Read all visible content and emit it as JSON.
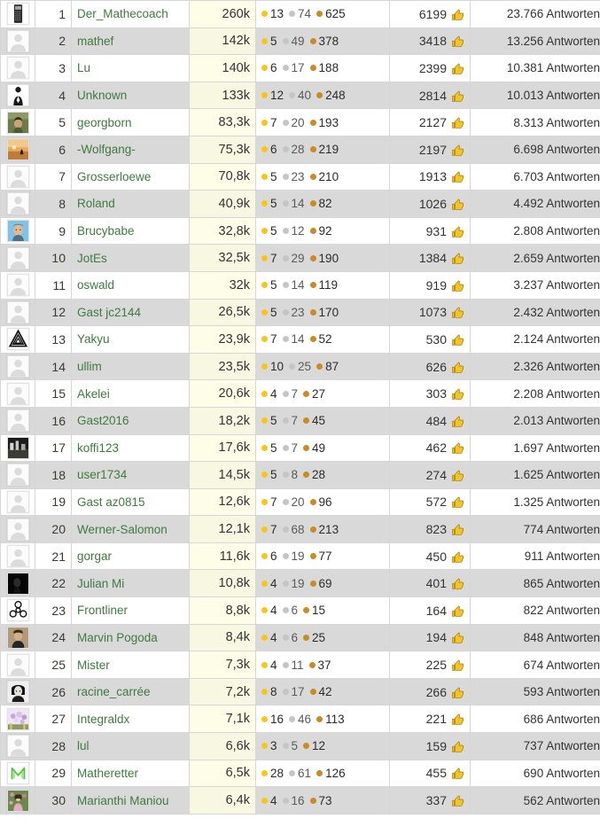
{
  "table": {
    "answers_suffix": "Antworten",
    "colors": {
      "gold": "#fcc418",
      "silver": "#c5c5c5",
      "bronze": "#cc8a24",
      "username": "#3f7a3f",
      "reputation_cell_bg": "#fdfde8",
      "row_even_bg": "#d9d9d9",
      "heart": "#d93025",
      "thumb": "#f5c518"
    },
    "icons": {
      "thumbs_up": "thumbs-up-icon",
      "heart": "heart-icon",
      "gold_badge": "gold-badge-dot",
      "silver_badge": "silver-badge-dot",
      "bronze_badge": "bronze-badge-dot"
    },
    "rows": [
      {
        "rank": "1",
        "name": "Der_Mathecoach",
        "reputation": "260k",
        "gold": "13",
        "silver": "74",
        "bronze": "625",
        "votes": "6199",
        "answers": "23.766 Antworten",
        "heart": false,
        "avatar": "calculator"
      },
      {
        "rank": "2",
        "name": "mathef",
        "reputation": "142k",
        "gold": "5",
        "silver": "49",
        "bronze": "378",
        "votes": "3418",
        "answers": "13.256 Antworten",
        "heart": false,
        "avatar": "default"
      },
      {
        "rank": "3",
        "name": "Lu",
        "reputation": "140k",
        "gold": "6",
        "silver": "17",
        "bronze": "188",
        "votes": "2399",
        "answers": "10.381 Antworten",
        "heart": false,
        "avatar": "default"
      },
      {
        "rank": "4",
        "name": "Unknown",
        "reputation": "133k",
        "gold": "12",
        "silver": "40",
        "bronze": "248",
        "votes": "2814",
        "answers": "10.013 Antworten",
        "heart": false,
        "avatar": "suit"
      },
      {
        "rank": "5",
        "name": "georgborn",
        "reputation": "83,3k",
        "gold": "7",
        "silver": "20",
        "bronze": "193",
        "votes": "2127",
        "answers": "8.313 Antworten",
        "heart": false,
        "avatar": "photo-person"
      },
      {
        "rank": "6",
        "name": "-Wolfgang-",
        "reputation": "75,3k",
        "gold": "6",
        "silver": "28",
        "bronze": "219",
        "votes": "2197",
        "answers": "6.698 Antworten",
        "heart": false,
        "avatar": "photo-sunset"
      },
      {
        "rank": "7",
        "name": "Grosserloewe",
        "reputation": "70,8k",
        "gold": "5",
        "silver": "23",
        "bronze": "210",
        "votes": "1913",
        "answers": "6.703 Antworten",
        "heart": false,
        "avatar": "default"
      },
      {
        "rank": "8",
        "name": "Roland",
        "reputation": "40,9k",
        "gold": "5",
        "silver": "14",
        "bronze": "82",
        "votes": "1026",
        "answers": "4.492 Antworten",
        "heart": false,
        "avatar": "default"
      },
      {
        "rank": "9",
        "name": "Brucybabe",
        "reputation": "32,8k",
        "gold": "5",
        "silver": "12",
        "bronze": "92",
        "votes": "931",
        "answers": "2.808 Antworten",
        "heart": false,
        "avatar": "photo-face-blue"
      },
      {
        "rank": "10",
        "name": "JotEs",
        "reputation": "32,5k",
        "gold": "7",
        "silver": "29",
        "bronze": "190",
        "votes": "1384",
        "answers": "2.659 Antworten",
        "heart": true,
        "avatar": "default"
      },
      {
        "rank": "11",
        "name": "oswald",
        "reputation": "32k",
        "gold": "5",
        "silver": "14",
        "bronze": "119",
        "votes": "919",
        "answers": "3.237 Antworten",
        "heart": false,
        "avatar": "default"
      },
      {
        "rank": "12",
        "name": "Gast jc2144",
        "reputation": "26,5k",
        "gold": "5",
        "silver": "23",
        "bronze": "170",
        "votes": "1073",
        "answers": "2.432 Antworten",
        "heart": false,
        "avatar": "default"
      },
      {
        "rank": "13",
        "name": "Yakyu",
        "reputation": "23,9k",
        "gold": "7",
        "silver": "14",
        "bronze": "52",
        "votes": "530",
        "answers": "2.124 Antworten",
        "heart": false,
        "avatar": "penrose"
      },
      {
        "rank": "14",
        "name": "ullim",
        "reputation": "23,5k",
        "gold": "10",
        "silver": "25",
        "bronze": "87",
        "votes": "626",
        "answers": "2.326 Antworten",
        "heart": false,
        "avatar": "default"
      },
      {
        "rank": "15",
        "name": "Akelei",
        "reputation": "20,6k",
        "gold": "4",
        "silver": "7",
        "bronze": "27",
        "votes": "303",
        "answers": "2.208 Antworten",
        "heart": false,
        "avatar": "default"
      },
      {
        "rank": "16",
        "name": "Gast2016",
        "reputation": "18,2k",
        "gold": "5",
        "silver": "7",
        "bronze": "45",
        "votes": "484",
        "answers": "2.013 Antworten",
        "heart": false,
        "avatar": "default"
      },
      {
        "rank": "17",
        "name": "koffi123",
        "reputation": "17,6k",
        "gold": "5",
        "silver": "7",
        "bronze": "49",
        "votes": "462",
        "answers": "1.697 Antworten",
        "heart": false,
        "avatar": "photo-dark-scene"
      },
      {
        "rank": "18",
        "name": "user1734",
        "reputation": "14,5k",
        "gold": "5",
        "silver": "8",
        "bronze": "28",
        "votes": "274",
        "answers": "1.625 Antworten",
        "heart": false,
        "avatar": "default"
      },
      {
        "rank": "19",
        "name": "Gast az0815",
        "reputation": "12,6k",
        "gold": "7",
        "silver": "20",
        "bronze": "96",
        "votes": "572",
        "answers": "1.325 Antworten",
        "heart": false,
        "avatar": "default"
      },
      {
        "rank": "20",
        "name": "Werner-Salomon",
        "reputation": "12,1k",
        "gold": "7",
        "silver": "68",
        "bronze": "213",
        "votes": "823",
        "answers": "774 Antworten",
        "heart": false,
        "avatar": "default"
      },
      {
        "rank": "21",
        "name": "gorgar",
        "reputation": "11,6k",
        "gold": "6",
        "silver": "19",
        "bronze": "77",
        "votes": "450",
        "answers": "911 Antworten",
        "heart": false,
        "avatar": "default"
      },
      {
        "rank": "22",
        "name": "Julian Mi",
        "reputation": "10,8k",
        "gold": "4",
        "silver": "19",
        "bronze": "69",
        "votes": "401",
        "answers": "865 Antworten",
        "heart": false,
        "avatar": "photo-black"
      },
      {
        "rank": "23",
        "name": "Frontliner",
        "reputation": "8,8k",
        "gold": "4",
        "silver": "6",
        "bronze": "15",
        "votes": "164",
        "answers": "822 Antworten",
        "heart": false,
        "avatar": "biohazard"
      },
      {
        "rank": "24",
        "name": "Marvin Pogoda",
        "reputation": "8,4k",
        "gold": "4",
        "silver": "6",
        "bronze": "25",
        "votes": "194",
        "answers": "848 Antworten",
        "heart": false,
        "avatar": "photo-portrait"
      },
      {
        "rank": "25",
        "name": "Mister",
        "reputation": "7,3k",
        "gold": "4",
        "silver": "11",
        "bronze": "37",
        "votes": "225",
        "answers": "674 Antworten",
        "heart": false,
        "avatar": "default"
      },
      {
        "rank": "26",
        "name": "racine_carrée",
        "reputation": "7,2k",
        "gold": "8",
        "silver": "17",
        "bronze": "42",
        "votes": "266",
        "answers": "593 Antworten",
        "heart": false,
        "avatar": "photo-bw-woman"
      },
      {
        "rank": "27",
        "name": "Integraldx",
        "reputation": "7,1k",
        "gold": "16",
        "silver": "46",
        "bronze": "113",
        "votes": "221",
        "answers": "686 Antworten",
        "heart": false,
        "avatar": "photo-flowers"
      },
      {
        "rank": "28",
        "name": "lul",
        "reputation": "6,6k",
        "gold": "3",
        "silver": "5",
        "bronze": "12",
        "votes": "159",
        "answers": "737 Antworten",
        "heart": false,
        "avatar": "default"
      },
      {
        "rank": "29",
        "name": "Matheretter",
        "reputation": "6,5k",
        "gold": "28",
        "silver": "61",
        "bronze": "126",
        "votes": "455",
        "answers": "690 Antworten",
        "heart": false,
        "avatar": "logo-m-green"
      },
      {
        "rank": "30",
        "name": "Marianthi Maniou",
        "reputation": "6,4k",
        "gold": "4",
        "silver": "16",
        "bronze": "73",
        "votes": "337",
        "answers": "562 Antworten",
        "heart": true,
        "avatar": "photo-woman-pink"
      }
    ]
  }
}
